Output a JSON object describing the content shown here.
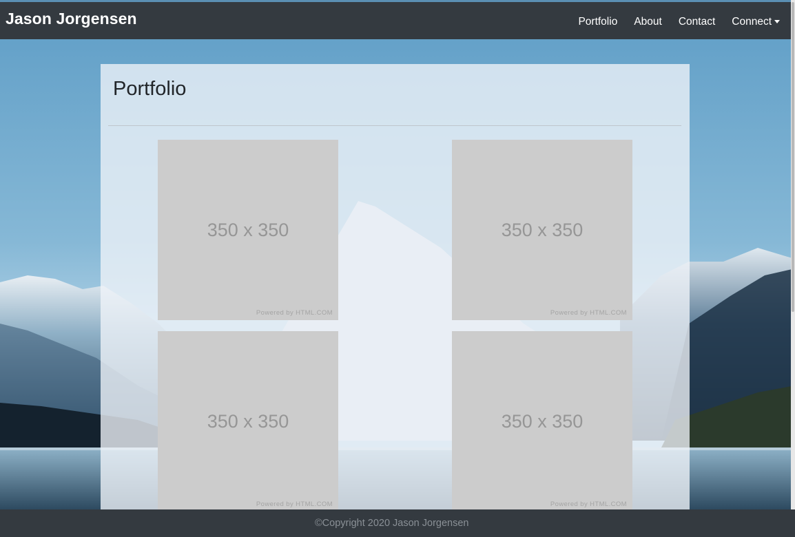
{
  "navbar": {
    "brand": "Jason Jorgensen",
    "links": [
      {
        "label": "Portfolio"
      },
      {
        "label": "About"
      },
      {
        "label": "Contact"
      },
      {
        "label": "Connect"
      }
    ]
  },
  "portfolio": {
    "title": "Portfolio",
    "tiles": [
      {
        "label": "350 x 350",
        "credit": "Powered by HTML.COM"
      },
      {
        "label": "350 x 350",
        "credit": "Powered by HTML.COM"
      },
      {
        "label": "350 x 350",
        "credit": "Powered by HTML.COM"
      },
      {
        "label": "350 x 350",
        "credit": "Powered by HTML.COM"
      }
    ]
  },
  "footer": {
    "copyright": "©Copyright 2020 Jason Jorgensen"
  },
  "colors": {
    "navbar": "#343a40",
    "tile": "#cccccc",
    "sky": "#6aa4c8"
  }
}
